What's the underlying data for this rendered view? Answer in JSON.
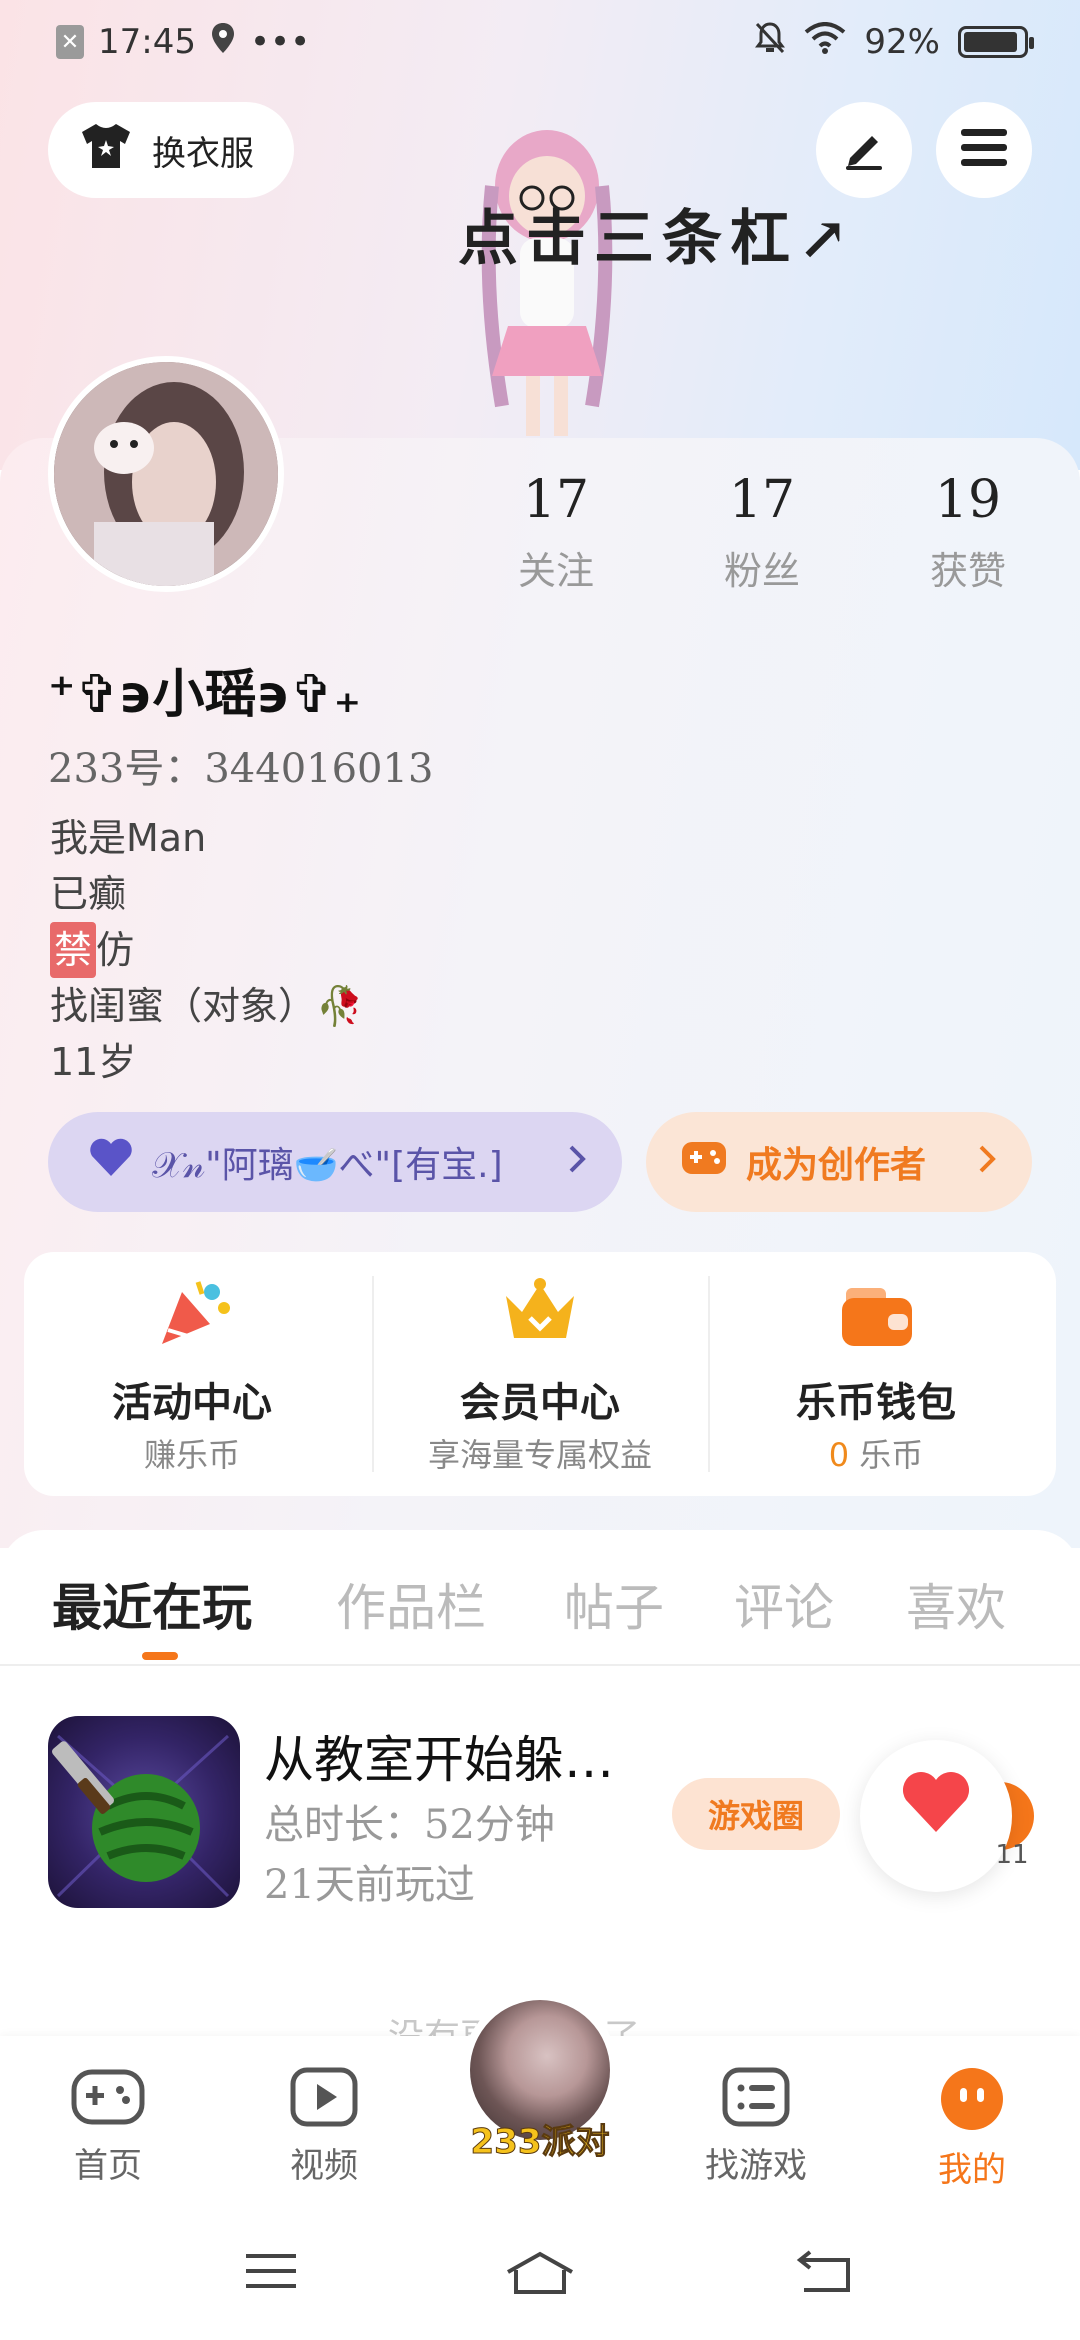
{
  "status_bar": {
    "time": "17:45",
    "battery": "92%",
    "battery_level": 0.92,
    "dots": "•••"
  },
  "header": {
    "outfit_label": "换衣服",
    "hint_text": "点击三条杠↗"
  },
  "profile": {
    "stats": [
      {
        "value": "17",
        "label": "关注"
      },
      {
        "value": "17",
        "label": "粉丝"
      },
      {
        "value": "19",
        "label": "获赞"
      }
    ],
    "username": "⁺✞϶小瑶϶✞₊",
    "user_id": "233号：344016013",
    "bio_lines": [
      "我是Man",
      "已癫",
      "禁",
      "仿",
      "找闺蜜（对象）🥀",
      "11岁"
    ]
  },
  "pills": {
    "friend_label": "𝒳𝓃\"阿璃🥣べ\"[有宝.]",
    "creator_label": "成为创作者"
  },
  "quick_actions": [
    {
      "title": "活动中心",
      "subtitle": "赚乐币"
    },
    {
      "title": "会员中心",
      "subtitle": "享海量专属权益"
    },
    {
      "title": "乐币钱包",
      "subtitle_num": "0",
      "subtitle": "乐币"
    }
  ],
  "tabs": [
    "最近在玩",
    "作品栏",
    "帖子",
    "评论",
    "喜欢"
  ],
  "recent_game": {
    "title": "从教室开始躲…",
    "duration": "总时长：52分钟",
    "last_played": "21天前玩过",
    "circle_button": "游戏圈",
    "like_count": "11"
  },
  "end_text": "没有更多游戏了",
  "bottom_nav": {
    "home": "首页",
    "video": "视频",
    "center": "233派对",
    "find_game": "找游戏",
    "mine": "我的"
  },
  "colors": {
    "accent": "#f5761a",
    "friend_pill": "#dcd6f2",
    "creator_pill": "#fbe5d6"
  }
}
